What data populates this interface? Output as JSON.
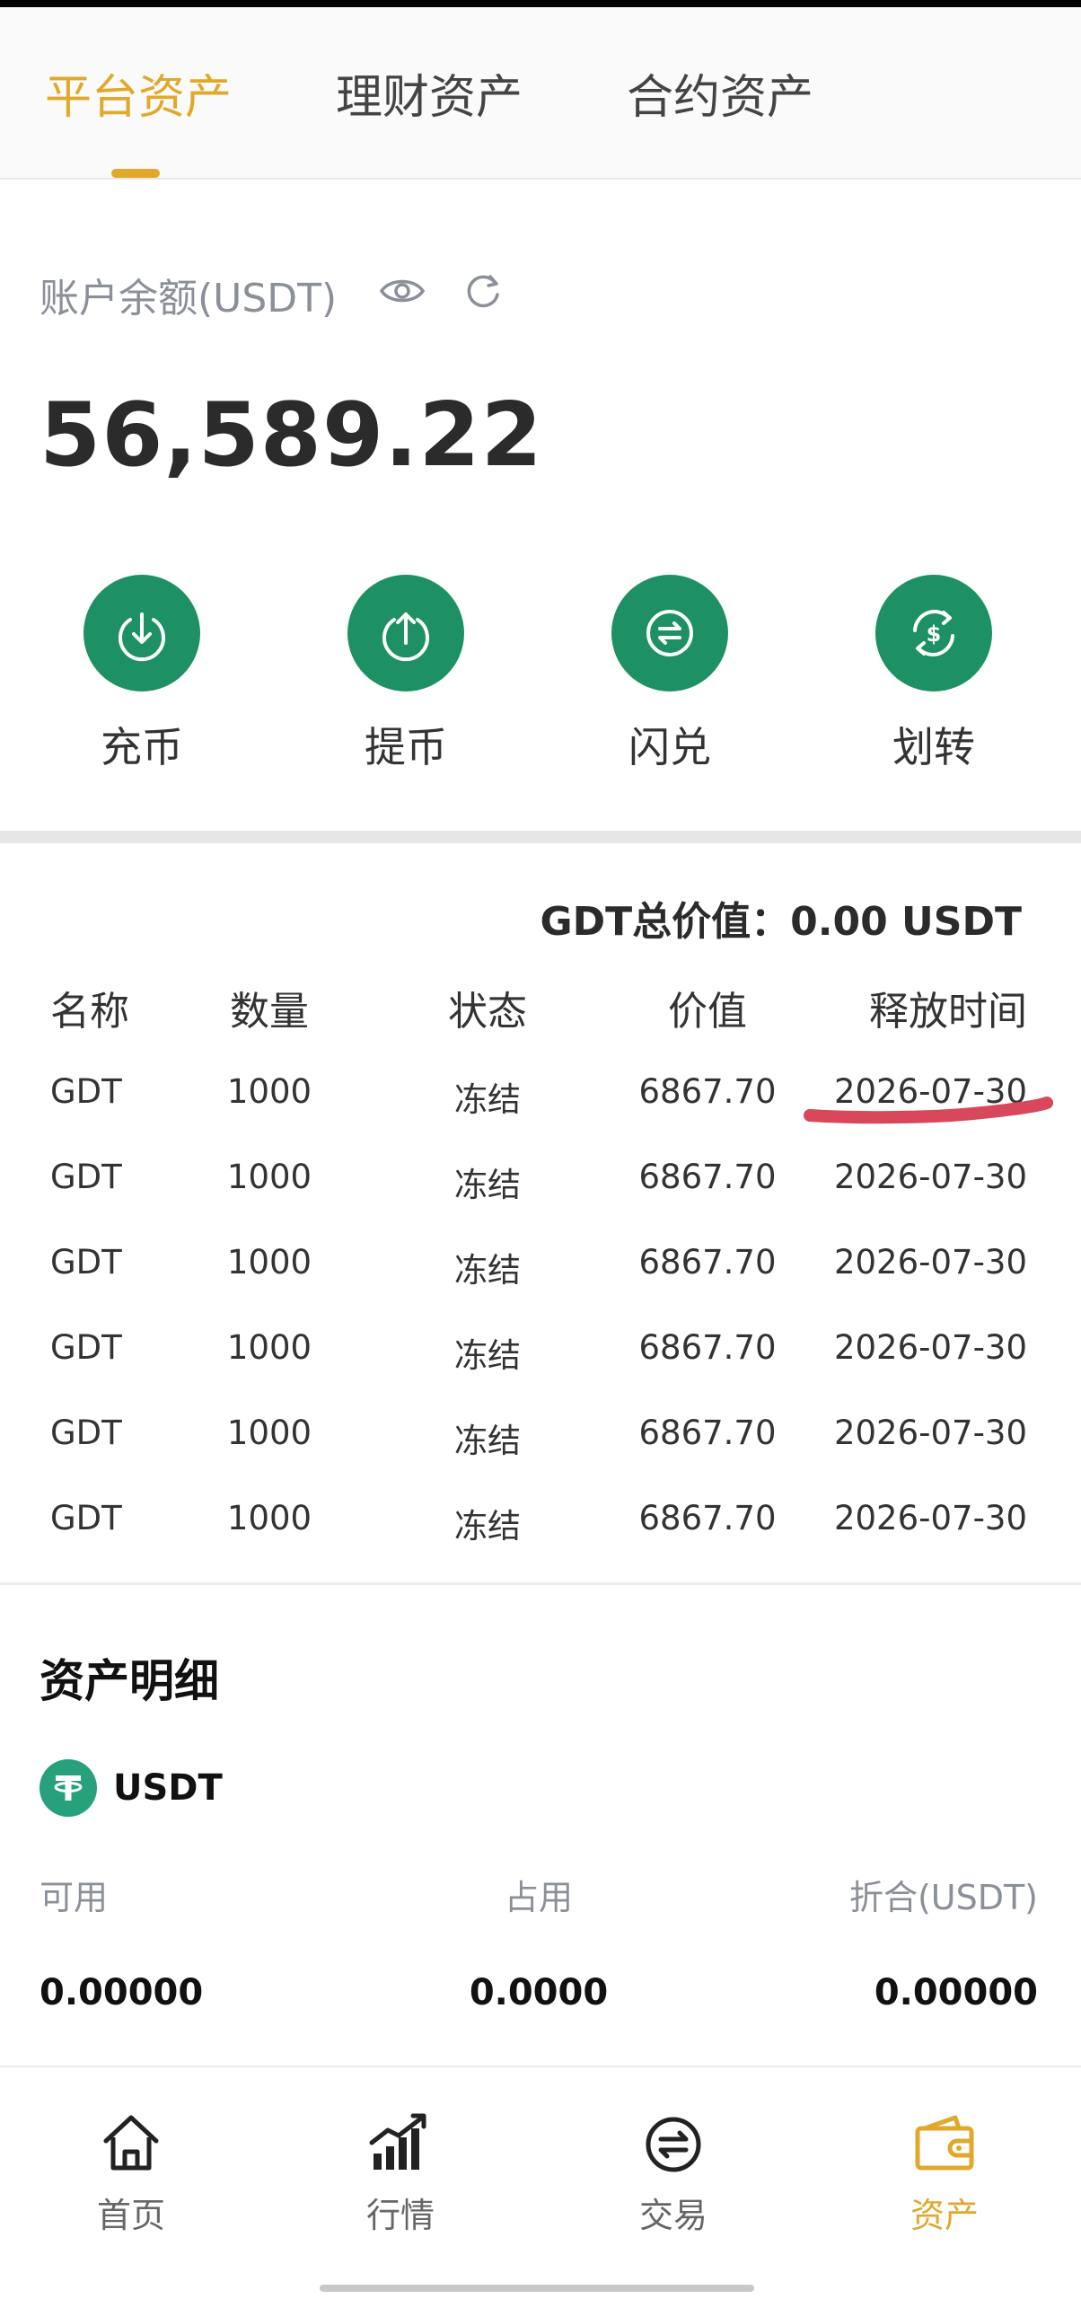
{
  "tabs": [
    {
      "label": "平台资产",
      "active": true
    },
    {
      "label": "理财资产",
      "active": false
    },
    {
      "label": "合约资产",
      "active": false
    }
  ],
  "balance": {
    "label": "账户余额(USDT)",
    "value": "56,589.22",
    "icons": [
      "eye-icon",
      "refresh-icon"
    ]
  },
  "actions": [
    {
      "label": "充币",
      "icon": "deposit-icon"
    },
    {
      "label": "提币",
      "icon": "withdraw-icon"
    },
    {
      "label": "闪兑",
      "icon": "swap-icon"
    },
    {
      "label": "划转",
      "icon": "transfer-icon"
    }
  ],
  "gdt": {
    "total_label": "GDT总价值：",
    "total_value": "0.00 USDT"
  },
  "table": {
    "headers": [
      "名称",
      "数量",
      "状态",
      "价值",
      "释放时间"
    ],
    "rows": [
      [
        "GDT",
        "1000",
        "冻结",
        "6867.70",
        "2026-07-30"
      ],
      [
        "GDT",
        "1000",
        "冻结",
        "6867.70",
        "2026-07-30"
      ],
      [
        "GDT",
        "1000",
        "冻结",
        "6867.70",
        "2026-07-30"
      ],
      [
        "GDT",
        "1000",
        "冻结",
        "6867.70",
        "2026-07-30"
      ],
      [
        "GDT",
        "1000",
        "冻结",
        "6867.70",
        "2026-07-30"
      ],
      [
        "GDT",
        "1000",
        "冻结",
        "6867.70",
        "2026-07-30"
      ]
    ]
  },
  "detail": {
    "title": "资产明细",
    "coin": "USDT",
    "available_label": "可用",
    "occupied_label": "占用",
    "converted_label": "折合(USDT)",
    "available_value": "0.00000",
    "occupied_value": "0.0000",
    "converted_value": "0.00000"
  },
  "nav": [
    {
      "label": "首页",
      "icon": "home-icon",
      "active": false
    },
    {
      "label": "行情",
      "icon": "market-chart-icon",
      "active": false
    },
    {
      "label": "交易",
      "icon": "trade-icon",
      "active": false
    },
    {
      "label": "资产",
      "icon": "wallet-icon",
      "active": true
    }
  ],
  "colors": {
    "accent": "#e0a92c",
    "green": "#1d9163",
    "usdt_green": "#26a17b",
    "annotation_red": "#d9475a"
  }
}
